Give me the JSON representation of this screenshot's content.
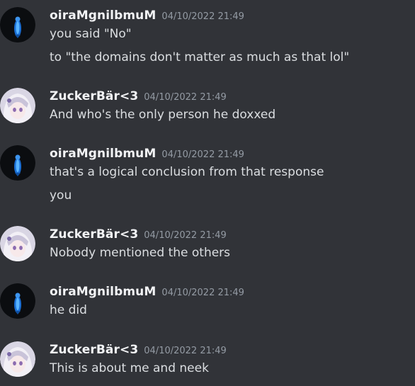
{
  "messages": [
    {
      "author": "oiraMgnilbmuM",
      "timestamp": "04/10/2022 21:49",
      "avatar_icon": "dark-avatar-with-blue-figure",
      "lines": [
        "you said \"No\"",
        "to \"the domains don't matter as much as that lol\""
      ]
    },
    {
      "author": "ZuckerBär<3",
      "timestamp": "04/10/2022 21:49",
      "avatar_icon": "anime-girl-avatar",
      "lines": [
        "And who's the only person he doxxed"
      ]
    },
    {
      "author": "oiraMgnilbmuM",
      "timestamp": "04/10/2022 21:49",
      "avatar_icon": "dark-avatar-with-blue-figure",
      "lines": [
        "that's a logical conclusion from that response",
        "you"
      ]
    },
    {
      "author": "ZuckerBär<3",
      "timestamp": "04/10/2022 21:49",
      "avatar_icon": "anime-girl-avatar",
      "lines": [
        "Nobody mentioned the others"
      ]
    },
    {
      "author": "oiraMgnilbmuM",
      "timestamp": "04/10/2022 21:49",
      "avatar_icon": "dark-avatar-with-blue-figure",
      "lines": [
        "he did"
      ]
    },
    {
      "author": "ZuckerBär<3",
      "timestamp": "04/10/2022 21:49",
      "avatar_icon": "anime-girl-avatar",
      "lines": [
        "This is about me and neek"
      ]
    }
  ],
  "colors": {
    "background": "#313338",
    "username": "#f2f3f5",
    "message_text": "#dbdee1",
    "timestamp": "#949ba4"
  }
}
